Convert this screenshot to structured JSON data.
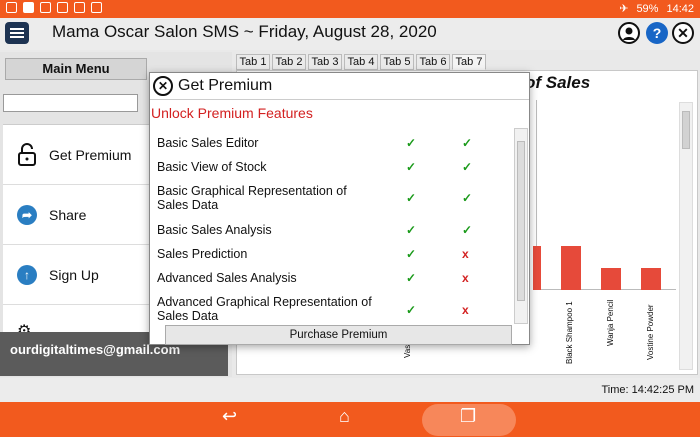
{
  "status_bar": {
    "battery": "59%",
    "time": "14:42"
  },
  "app": {
    "title": "Mama Oscar Salon SMS ~ Friday, August 28, 2020"
  },
  "left_panel": {
    "main_menu_label": "Main Menu",
    "menu_items": [
      {
        "label": "Get Premium",
        "icon": "lock-icon"
      },
      {
        "label": "Share",
        "icon": "share-icon"
      },
      {
        "label": "Sign Up",
        "icon": "sign-up-icon"
      },
      {
        "label": "",
        "icon": "gear-icon"
      }
    ],
    "email": "ourdigitaltimes@gmail.com"
  },
  "tabs": [
    "Tab 1",
    "Tab 2",
    "Tab 3",
    "Tab 4",
    "Tab 5",
    "Tab 6",
    "Tab 7"
  ],
  "chart": {
    "title_partial": "of Sales",
    "visible_labels": [
      "Vas",
      "Black Shampoo 1",
      "Wanja Pencil",
      "Vostine Powder"
    ]
  },
  "dialog": {
    "title": "Get Premium",
    "subtitle": "Unlock Premium Features",
    "features": [
      {
        "name": "Basic Sales Editor",
        "col1": "✓",
        "col2": "✓"
      },
      {
        "name": "Basic View of Stock",
        "col1": "✓",
        "col2": "✓"
      },
      {
        "name": "Basic Graphical Representation of Sales Data",
        "col1": "✓",
        "col2": "✓"
      },
      {
        "name": "Basic Sales Analysis",
        "col1": "✓",
        "col2": "✓"
      },
      {
        "name": "Sales Prediction",
        "col1": "✓",
        "col2": "x"
      },
      {
        "name": "Advanced Sales Analysis",
        "col1": "✓",
        "col2": "x"
      },
      {
        "name": "Advanced Graphical Representation of Sales Data",
        "col1": "✓",
        "col2": "x"
      }
    ],
    "purchase_label": "Purchase Premium"
  },
  "footer": {
    "time_label": "Time: 14:42:25 PM"
  },
  "colors": {
    "accent": "#f25a1e",
    "yes": "#1a9a1a",
    "no": "#d32121",
    "bar": "#e64a3a"
  }
}
